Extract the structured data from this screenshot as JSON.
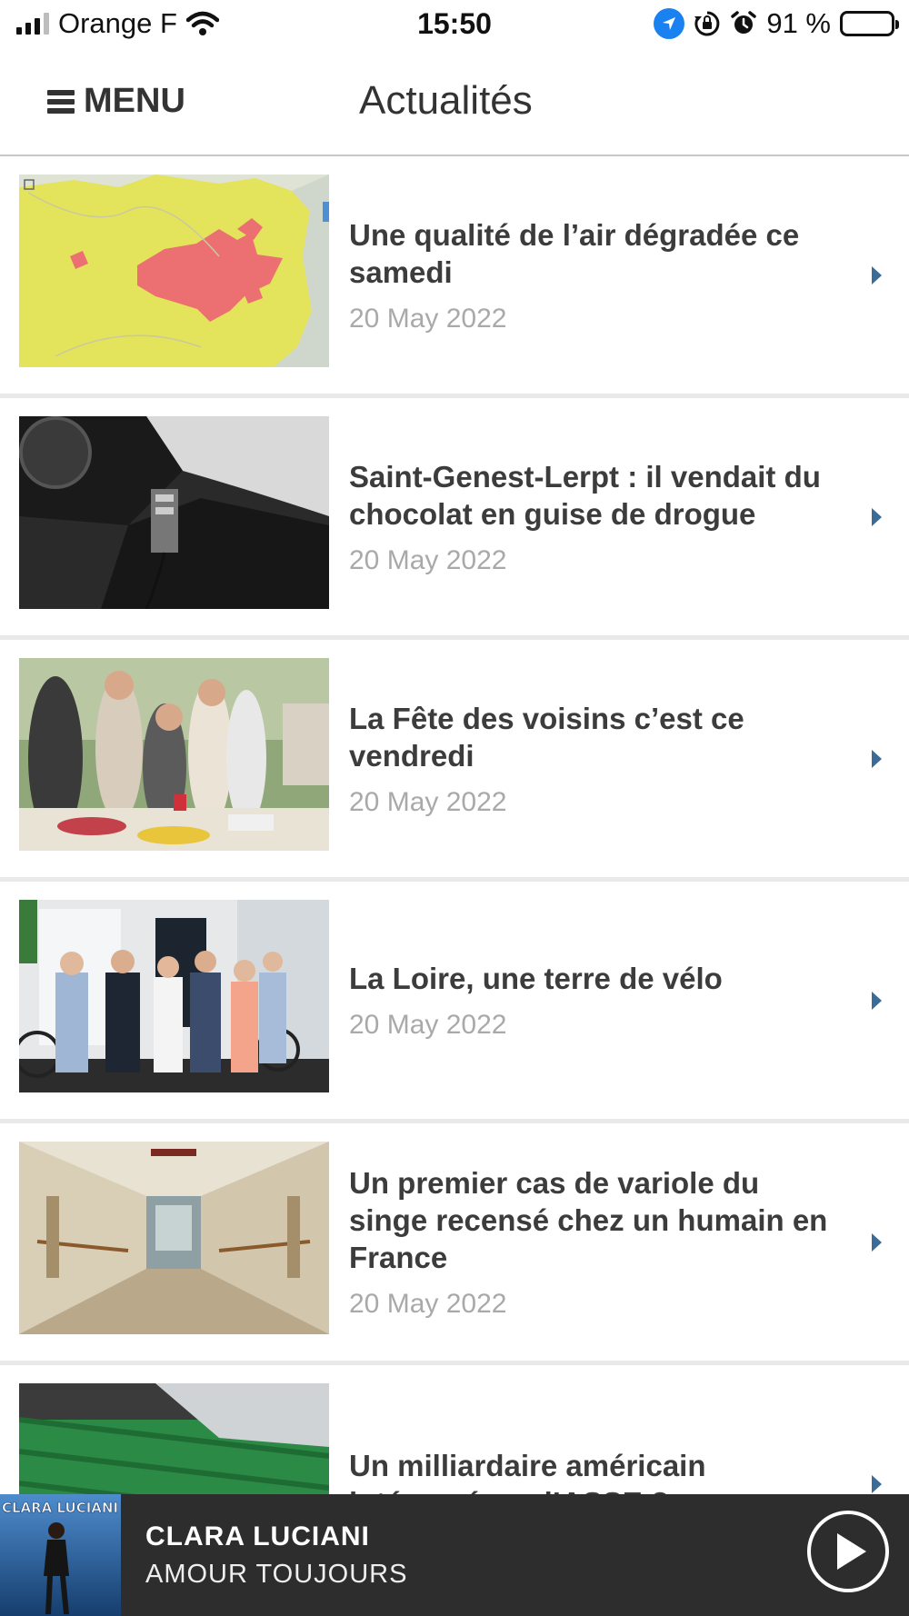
{
  "status_bar": {
    "carrier": "Orange F",
    "time": "15:50",
    "battery": "91 %",
    "battery_level": 0.91
  },
  "header": {
    "menu_label": "MENU",
    "title": "Actualités"
  },
  "articles": [
    {
      "title": "Une qualité de l’air dégradée ce samedi",
      "date": "20 May 2022",
      "thumbnail": "air-quality-map"
    },
    {
      "title": "Saint-Genest-Lerpt : il vendait du chocolat en guise de drogue",
      "date": "20 May 2022",
      "thumbnail": "police-car-interior"
    },
    {
      "title": "La Fête des voisins c’est ce vendredi",
      "date": "20 May 2022",
      "thumbnail": "neighbours-party"
    },
    {
      "title": "La Loire, une terre de vélo",
      "date": "20 May 2022",
      "thumbnail": "group-photo-bikes"
    },
    {
      "title": "Un premier cas de variole du singe recensé chez un humain en France",
      "date": "20 May 2022",
      "thumbnail": "hospital-corridor"
    },
    {
      "title": "Un milliardaire américain intéressé par l’ASSE ?",
      "date": "",
      "thumbnail": "stadium-seats"
    }
  ],
  "player": {
    "artist": "CLARA LUCIANI",
    "track": "AMOUR TOUJOURS",
    "cover_text": "CLARA LUCIANI"
  },
  "colors": {
    "chevron": "#3b6b97",
    "player_bg": "#2d2d2d",
    "location_icon": "#1a82f0"
  }
}
